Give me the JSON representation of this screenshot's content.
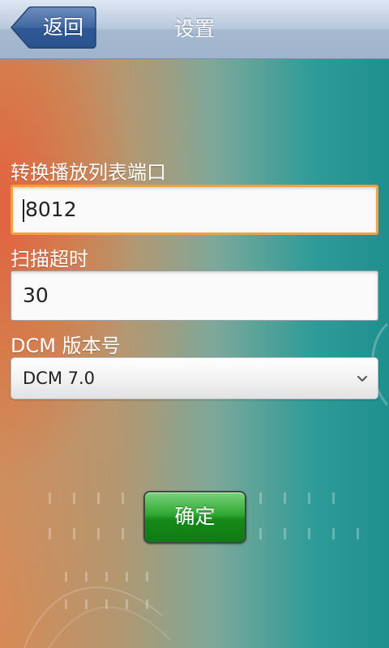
{
  "header": {
    "title": "设置",
    "back_label": "返回"
  },
  "form": {
    "port_label": "转换播放列表端口",
    "port_value": "8012",
    "timeout_label": "扫描超时",
    "timeout_value": "30",
    "dcm_label": "DCM 版本号",
    "dcm_selected": "DCM 7.0"
  },
  "actions": {
    "confirm_label": "确定"
  },
  "colors": {
    "focus_border": "#f2a23a",
    "confirm_green": "#168a1a",
    "topbar_blue": "#a6b9d1"
  }
}
